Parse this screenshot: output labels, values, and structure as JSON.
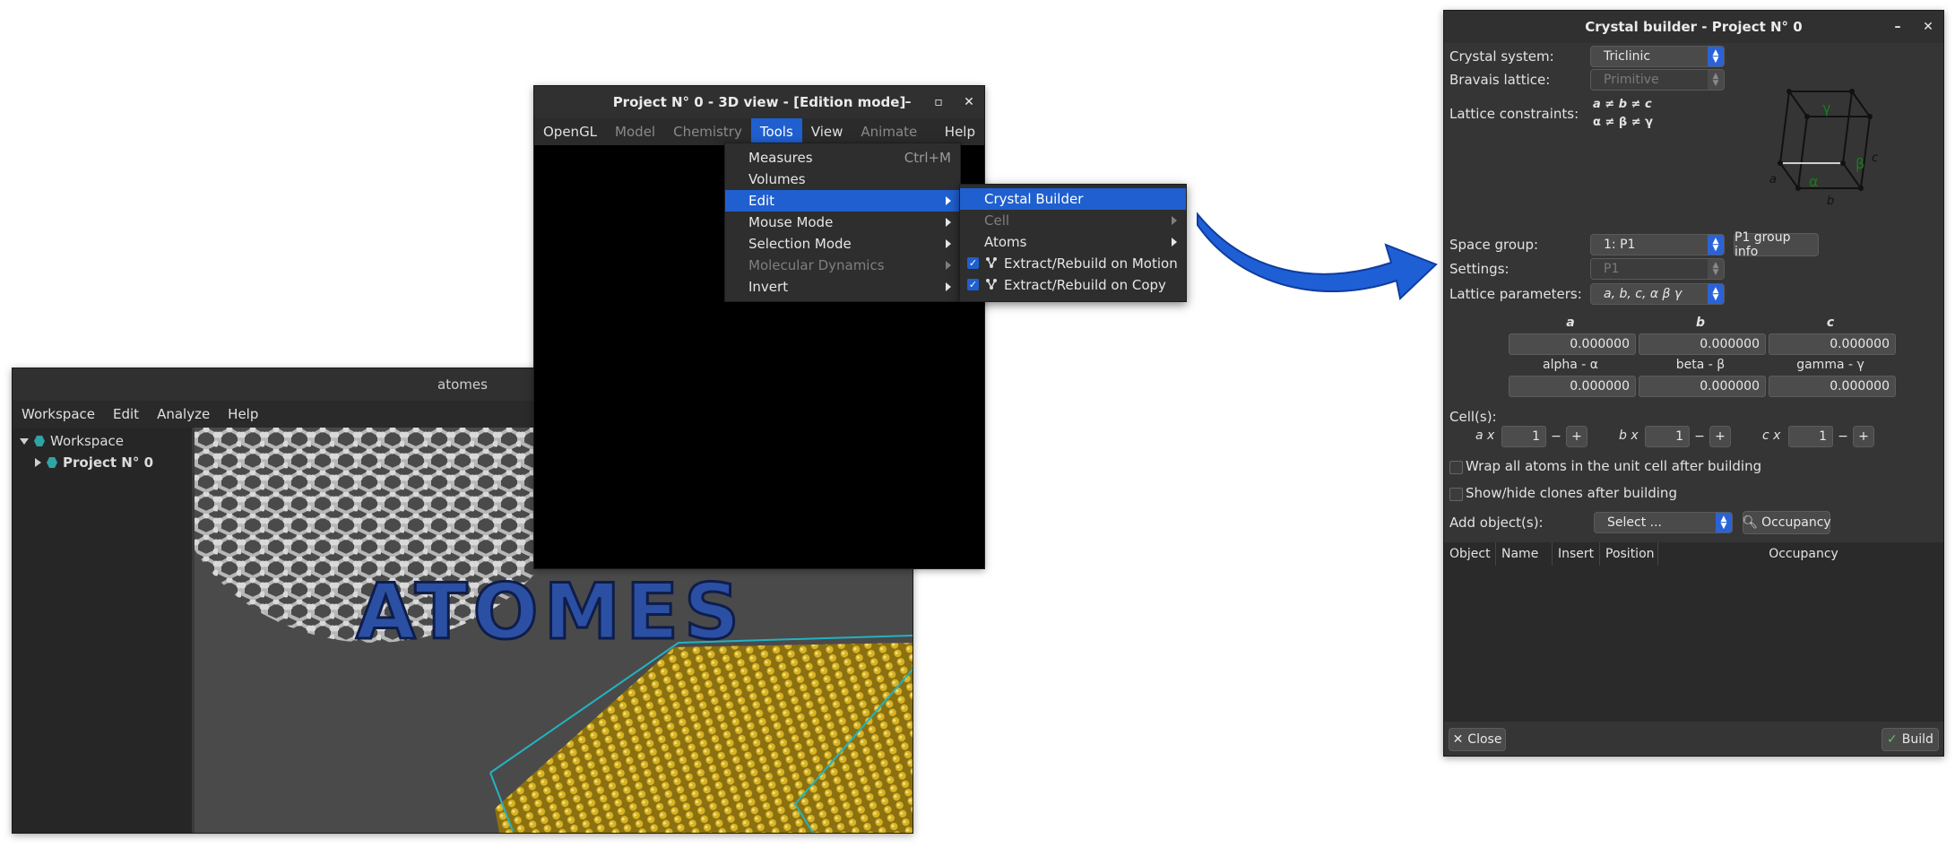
{
  "atomes": {
    "title": "atomes",
    "menu": [
      "Workspace",
      "Edit",
      "Analyze",
      "Help"
    ],
    "tree": {
      "root": "Workspace",
      "child": "Project N° 0"
    },
    "logo_text": "ATOMES"
  },
  "view3d": {
    "title": "Project N° 0 - 3D view - [Edition mode]",
    "menu": [
      {
        "label": "OpenGL",
        "state": "normal"
      },
      {
        "label": "Model",
        "state": "disabled"
      },
      {
        "label": "Chemistry",
        "state": "disabled"
      },
      {
        "label": "Tools",
        "state": "active"
      },
      {
        "label": "View",
        "state": "normal"
      },
      {
        "label": "Animate",
        "state": "disabled"
      },
      {
        "label": "Help",
        "state": "normal"
      }
    ],
    "tools_menu": [
      {
        "label": "Measures",
        "accel": "Ctrl+M"
      },
      {
        "label": "Volumes"
      },
      {
        "label": "Edit",
        "submenu": true,
        "selected": true
      },
      {
        "label": "Mouse Mode",
        "submenu": true
      },
      {
        "label": "Selection Mode",
        "submenu": true
      },
      {
        "label": "Molecular Dynamics",
        "submenu": true,
        "disabled": true
      },
      {
        "label": "Invert",
        "submenu": true
      }
    ],
    "edit_menu": [
      {
        "label": "Crystal Builder",
        "selected": true
      },
      {
        "label": "Cell",
        "submenu": true,
        "disabled": true
      },
      {
        "label": "Atoms",
        "submenu": true
      },
      {
        "label": "Extract/Rebuild on Motion",
        "checked": true
      },
      {
        "label": "Extract/Rebuild on Copy",
        "checked": true
      }
    ]
  },
  "crystal": {
    "title": "Crystal builder - Project N° 0",
    "crystal_system_label": "Crystal system:",
    "crystal_system": "Triclinic",
    "bravais_label": "Bravais lattice:",
    "bravais": "Primitive",
    "constraints_label": "Lattice constraints:",
    "constraints_1": "a ≠ b ≠ c",
    "constraints_2": "α ≠ β ≠ γ",
    "space_group_label": "Space group:",
    "space_group": "1: P1",
    "group_info": "P1 group info",
    "settings_label": "Settings:",
    "settings": "P1",
    "lattice_label": "Lattice parameters:",
    "lattice": "a, b, c, α β γ",
    "params": {
      "a_h": "a",
      "b_h": "b",
      "c_h": "c",
      "a": "0.000000",
      "b": "0.000000",
      "c": "0.000000",
      "alpha_h": "alpha - α",
      "beta_h": "beta - β",
      "gamma_h": "gamma - γ",
      "alpha": "0.000000",
      "beta": "0.000000",
      "gamma": "0.000000"
    },
    "cells_label": "Cell(s):",
    "cells": {
      "ax": "a x",
      "bx": "b x",
      "cx": "c x",
      "a": "1",
      "b": "1",
      "c": "1"
    },
    "wrap_label": "Wrap all atoms in the unit cell after building",
    "clones_label": "Show/hide clones after building",
    "add_label": "Add object(s):",
    "add_select": "Select ...",
    "occupancy_btn": "Occupancy",
    "table_headers": [
      "Object",
      "Name",
      "Insert",
      "Position",
      "Occupancy"
    ],
    "close": "Close",
    "build": "Build",
    "diagram": {
      "a": "a",
      "b": "b",
      "c": "c",
      "alpha": "α",
      "beta": "β",
      "gamma": "γ"
    }
  }
}
